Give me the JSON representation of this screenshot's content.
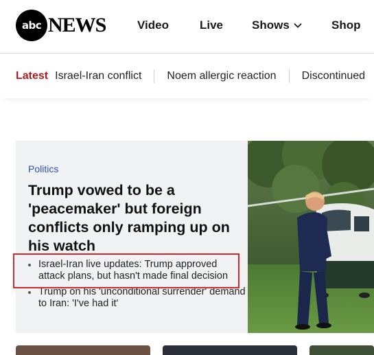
{
  "brand": {
    "logo_mark": "abc",
    "logo_word": "NEWS"
  },
  "nav": {
    "video": "Video",
    "live": "Live",
    "shows": "Shows",
    "shop": "Shop"
  },
  "trending": {
    "latest_label": "Latest",
    "items": [
      "Israel-Iran conflict",
      "Noem allergic reaction",
      "Discontinued"
    ]
  },
  "hero": {
    "category": "Politics",
    "headline": "Trump vowed to be a 'peacemaker' but foreign conflicts only ramping up on his watch",
    "related": [
      "Israel-Iran live updates: Trump approved attack plans, but hasn't made final decision",
      "Trump on his 'unconditional surrender' demand to Iran: 'I've had it'"
    ]
  },
  "colors": {
    "accent_red": "#b21a20",
    "category_blue": "#2a4fbd",
    "highlight_red": "#d7262d"
  }
}
